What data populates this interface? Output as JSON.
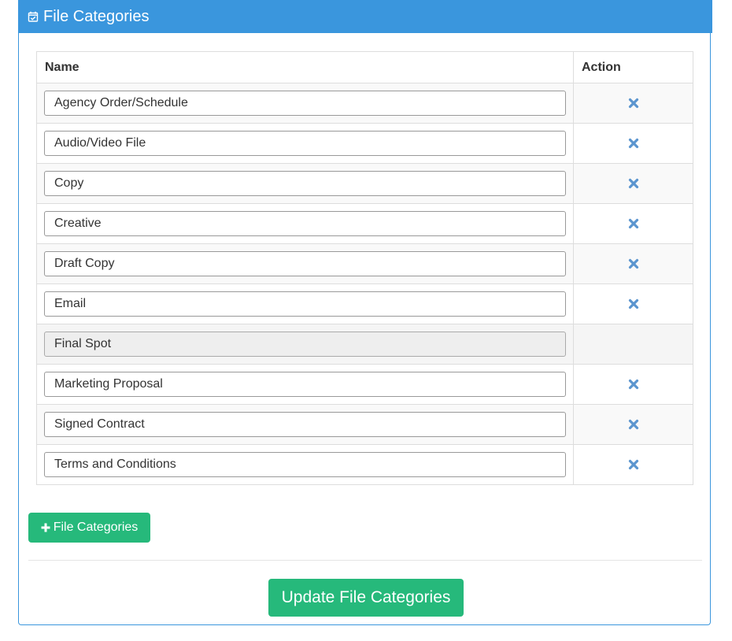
{
  "panel": {
    "title": "File Categories",
    "title_icon": "calendar-check-icon",
    "header_color": "#3a96dd"
  },
  "table": {
    "headers": {
      "name": "Name",
      "action": "Action"
    },
    "rows": [
      {
        "name": "Agency Order/Schedule",
        "deletable": true
      },
      {
        "name": "Audio/Video File",
        "deletable": true
      },
      {
        "name": "Copy",
        "deletable": true
      },
      {
        "name": "Creative",
        "deletable": true
      },
      {
        "name": "Draft Copy",
        "deletable": true
      },
      {
        "name": "Email",
        "deletable": true
      },
      {
        "name": "Final Spot",
        "deletable": false,
        "readonly": true
      },
      {
        "name": "Marketing Proposal",
        "deletable": true
      },
      {
        "name": "Signed Contract",
        "deletable": true
      },
      {
        "name": "Terms and Conditions",
        "deletable": true
      }
    ],
    "delete_icon": "times-icon",
    "delete_icon_color": "#5b95cf"
  },
  "buttons": {
    "add_label": "File Categories",
    "add_icon": "plus-icon",
    "update_label": "Update File Categories",
    "button_color": "#26b97b"
  }
}
